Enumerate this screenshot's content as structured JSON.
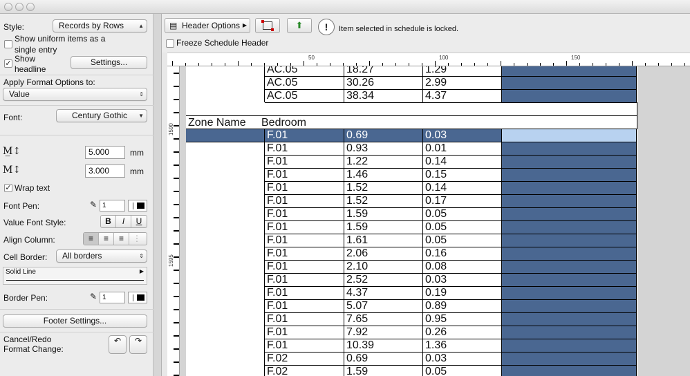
{
  "left_panel": {
    "style_label": "Style:",
    "style_value": "Records by Rows",
    "uniform_label_1": "Show uniform items as a",
    "uniform_label_2": "single entry",
    "headline_label_1": "Show",
    "headline_label_2": "headline",
    "settings_button": "Settings...",
    "apply_label": "Apply Format Options to:",
    "apply_value": "Value",
    "font_label": "Font:",
    "font_value": "Century Gothic",
    "height_value": "5.000",
    "height_unit": "mm",
    "width_value": "3.000",
    "width_unit": "mm",
    "wrap_label": "Wrap text",
    "font_pen_label": "Font Pen:",
    "font_pen_value": "1",
    "value_font_style_label": "Value Font Style:",
    "bold": "B",
    "italic": "I",
    "underline": "U",
    "align_label": "Align Column:",
    "cell_border_label": "Cell Border:",
    "cell_border_value": "All borders",
    "line_type": "Solid Line",
    "border_pen_label": "Border Pen:",
    "border_pen_value": "1",
    "footer_button": "Footer Settings...",
    "cancel_redo_1": "Cancel/Redo",
    "cancel_redo_2": "Format Change:"
  },
  "toolbar": {
    "header_options": "Header Options",
    "lock_message": "Item selected in schedule is locked.",
    "freeze_label": "Freeze Schedule Header"
  },
  "ruler": {
    "h_labels": [
      "50",
      "100",
      "150"
    ],
    "v_labels": [
      "1590",
      "1595"
    ]
  },
  "schedule": {
    "top_rows": [
      [
        "AC.05",
        "18.27",
        "1.29"
      ],
      [
        "AC.05",
        "30.26",
        "2.99"
      ],
      [
        "AC.05",
        "38.34",
        "4.37"
      ]
    ],
    "zone_label": "Zone Name",
    "zone_value": "Bedroom",
    "rows": [
      [
        "F.01",
        "0.69",
        "0.03"
      ],
      [
        "F.01",
        "0.93",
        "0.01"
      ],
      [
        "F.01",
        "1.22",
        "0.14"
      ],
      [
        "F.01",
        "1.46",
        "0.15"
      ],
      [
        "F.01",
        "1.52",
        "0.14"
      ],
      [
        "F.01",
        "1.52",
        "0.17"
      ],
      [
        "F.01",
        "1.59",
        "0.05"
      ],
      [
        "F.01",
        "1.59",
        "0.05"
      ],
      [
        "F.01",
        "1.61",
        "0.05"
      ],
      [
        "F.01",
        "2.06",
        "0.16"
      ],
      [
        "F.01",
        "2.10",
        "0.08"
      ],
      [
        "F.01",
        "2.52",
        "0.03"
      ],
      [
        "F.01",
        "4.37",
        "0.19"
      ],
      [
        "F.01",
        "5.07",
        "0.89"
      ],
      [
        "F.01",
        "7.65",
        "0.95"
      ],
      [
        "F.01",
        "7.92",
        "0.26"
      ],
      [
        "F.01",
        "10.39",
        "1.36"
      ],
      [
        "F.02",
        "0.69",
        "0.03"
      ],
      [
        "F.02",
        "1.59",
        "0.05"
      ]
    ]
  },
  "colors": {
    "fill": "#4a6791",
    "selected_light": "#b8d2f0"
  }
}
